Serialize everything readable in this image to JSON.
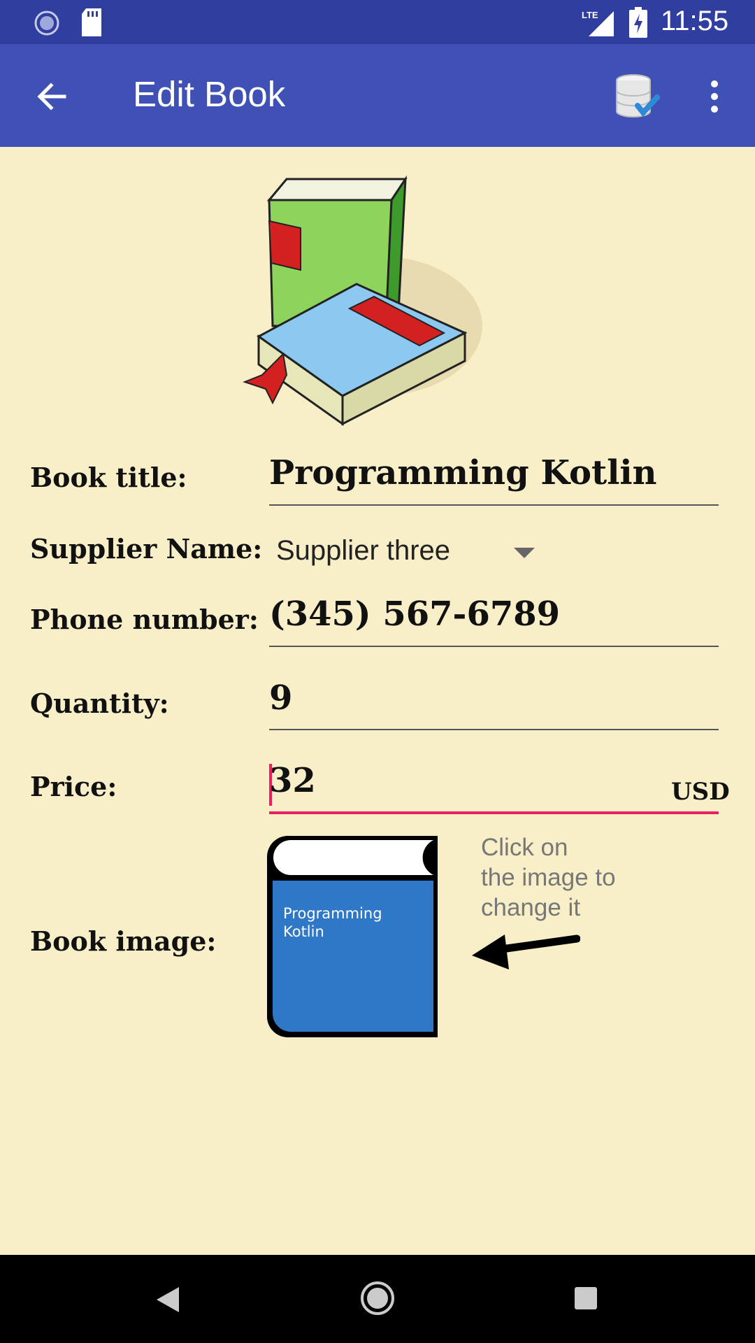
{
  "status_bar": {
    "time": "11:55",
    "network": "LTE"
  },
  "app_bar": {
    "title": "Edit Book"
  },
  "form": {
    "title": {
      "label": "Book title:",
      "value": "Programming Kotlin"
    },
    "supplier": {
      "label": "Supplier Name:",
      "value": "Supplier three"
    },
    "phone": {
      "label": "Phone number:",
      "value": "(345) 567-6789"
    },
    "quantity": {
      "label": "Quantity:",
      "value": "9"
    },
    "price": {
      "label": "Price:",
      "value": "32",
      "currency": "USD"
    },
    "image": {
      "label": "Book image:",
      "book_text": "Programming\nKotlin",
      "hint": "Click on\nthe image to\nchange it"
    }
  },
  "icons": [
    "clock-icon",
    "sd-card-icon",
    "lte-signal-icon",
    "battery-charging-icon",
    "back-arrow-icon",
    "database-check-icon",
    "overflow-menu-icon",
    "books-illustration-icon",
    "dropdown-arrow-icon",
    "arrow-left-icon",
    "nav-back-icon",
    "nav-home-icon",
    "nav-recents-icon"
  ],
  "colors": {
    "status_bar": "#303f9f",
    "app_bar": "#3f51b5",
    "background": "#f8efc8",
    "accent": "#e91e63",
    "book_cover": "#2f78c7"
  }
}
